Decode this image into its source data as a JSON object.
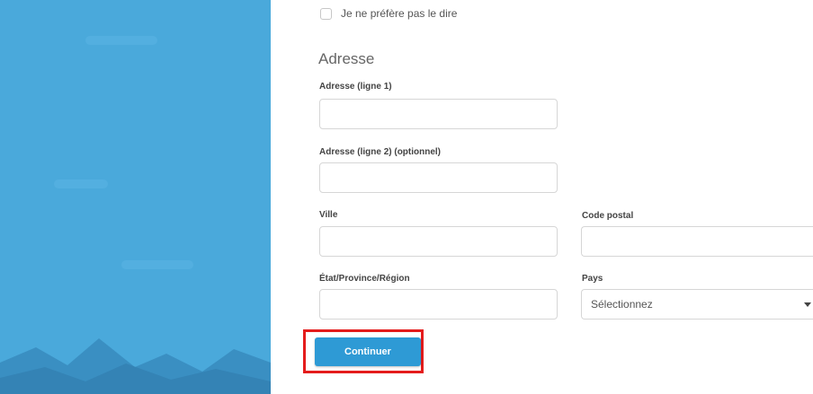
{
  "gender_option": {
    "label": "Je ne préfère pas le dire"
  },
  "address": {
    "title": "Adresse",
    "line1_label": "Adresse (ligne 1)",
    "line2_label": "Adresse (ligne 2) (optionnel)",
    "city_label": "Ville",
    "postal_label": "Code postal",
    "state_label": "État/Province/Région",
    "country_label": "Pays",
    "country_value": "Sélectionnez"
  },
  "actions": {
    "continue_label": "Continuer"
  },
  "colors": {
    "panel": "#4aa9db",
    "button": "#2e9ad5",
    "highlight": "#e41c1c"
  }
}
